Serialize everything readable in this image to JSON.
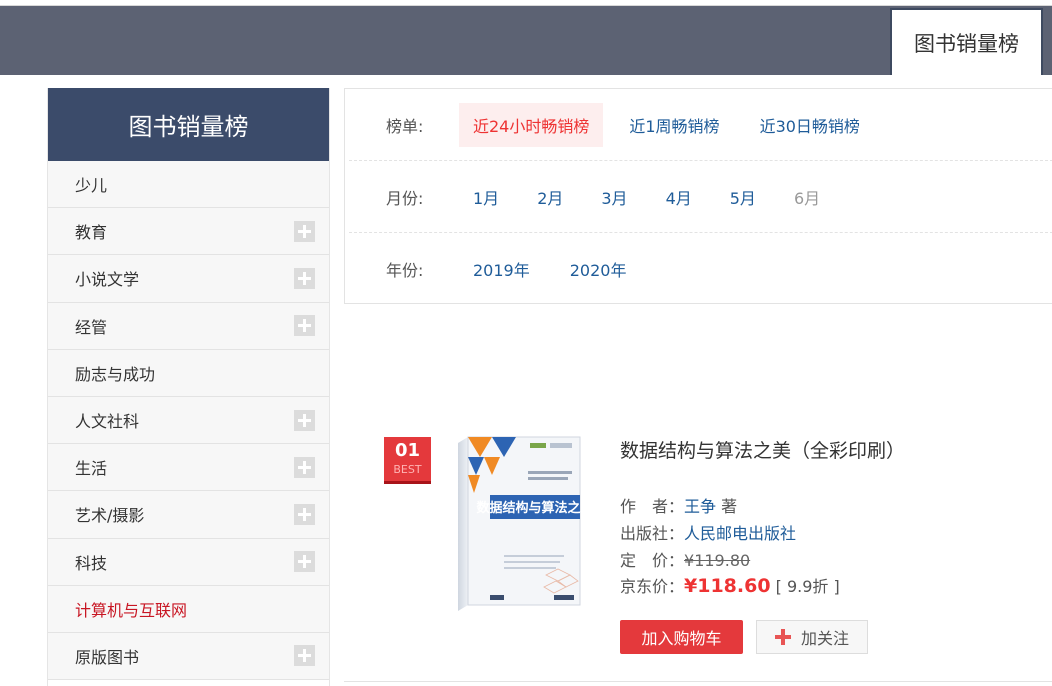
{
  "header": {
    "tab_label": "图书销量榜"
  },
  "sidebar": {
    "title": "图书销量榜",
    "items": [
      {
        "label": "少儿",
        "expandable": false,
        "active": false
      },
      {
        "label": "教育",
        "expandable": true,
        "active": false
      },
      {
        "label": "小说文学",
        "expandable": true,
        "active": false
      },
      {
        "label": "经管",
        "expandable": true,
        "active": false
      },
      {
        "label": "励志与成功",
        "expandable": false,
        "active": false
      },
      {
        "label": "人文社科",
        "expandable": true,
        "active": false
      },
      {
        "label": "生活",
        "expandable": true,
        "active": false
      },
      {
        "label": "艺术/摄影",
        "expandable": true,
        "active": false
      },
      {
        "label": "科技",
        "expandable": true,
        "active": false
      },
      {
        "label": "计算机与互联网",
        "expandable": false,
        "active": true
      },
      {
        "label": "原版图书",
        "expandable": true,
        "active": false
      }
    ]
  },
  "filters": {
    "list_label": "榜单:",
    "lists": [
      "近24小时畅销榜",
      "近1周畅销榜",
      "近30日畅销榜"
    ],
    "month_label": "月份:",
    "months": [
      "1月",
      "2月",
      "3月",
      "4月",
      "5月",
      "6月"
    ],
    "year_label": "年份:",
    "years": [
      "2019年",
      "2020年"
    ]
  },
  "book": {
    "rank": "01",
    "rank_badge": "BEST",
    "title": "数据结构与算法之美（全彩印刷）",
    "author_label": "作　者：",
    "author": "王争",
    "author_suffix": " 著",
    "publisher_label": "出版社：",
    "publisher": "人民邮电出版社",
    "list_price_label": "定　价：",
    "list_price": "¥119.80",
    "jd_price_label": "京东价：",
    "jd_price": "¥118.60",
    "discount": "[ 9.9折 ]",
    "cover_title": "数据结构与算法之美",
    "cart_button": "加入购物车",
    "follow_button": "加关注"
  },
  "colors": {
    "accent": "#e4393c",
    "link": "#1f5c99",
    "sidebar_head": "#3b4b6a",
    "topbar": "#5c6273"
  }
}
